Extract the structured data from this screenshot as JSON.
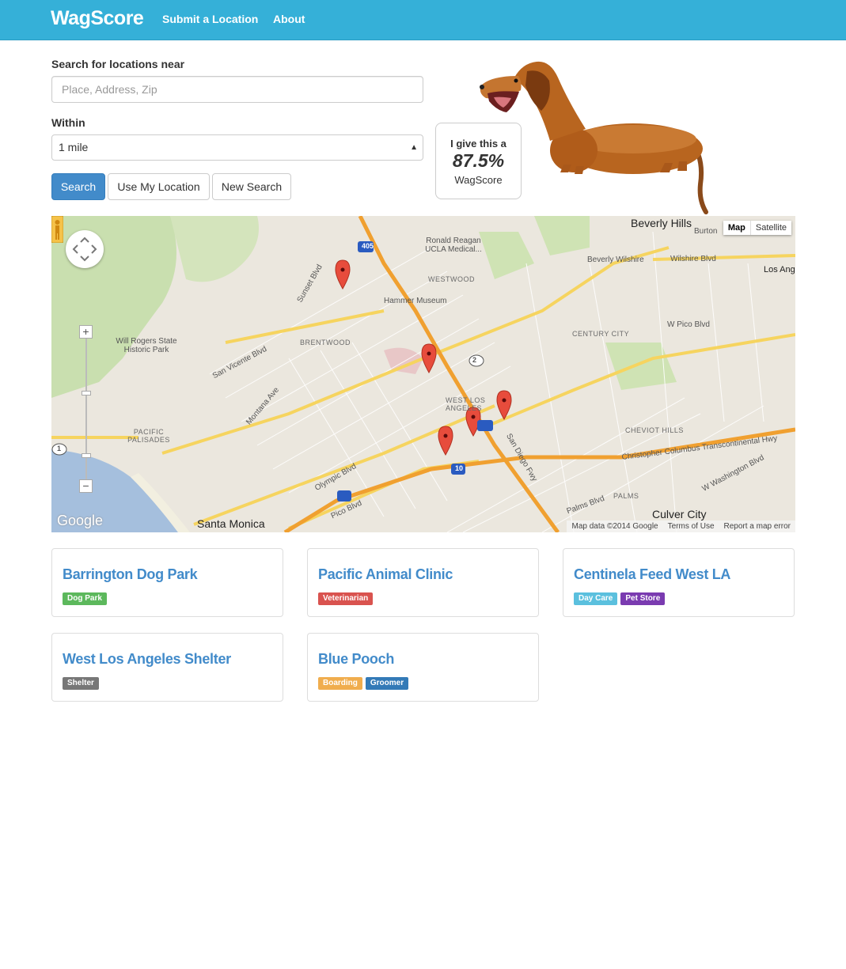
{
  "nav": {
    "brand": "WagScore",
    "links": [
      "Submit a Location",
      "About"
    ]
  },
  "search": {
    "near_label": "Search for locations near",
    "near_placeholder": "Place, Address, Zip",
    "near_value": "",
    "within_label": "Within",
    "within_selected": "1 mile",
    "buttons": {
      "search": "Search",
      "use_location": "Use My Location",
      "new_search": "New Search"
    }
  },
  "score": {
    "prefix": "I give this a",
    "value": "87.5%",
    "suffix": "WagScore"
  },
  "map": {
    "type_buttons": [
      "Map",
      "Satellite"
    ],
    "attribution": "Map data ©2014 Google",
    "terms": "Terms of Use",
    "report": "Report a map error",
    "google_logo": "Google",
    "labels": {
      "beverly_hills": "Beverly Hills",
      "burton": "Burton",
      "santa_monica": "Santa Monica",
      "culver_city": "Culver City",
      "brentwood": "BRENTWOOD",
      "westwood": "WESTWOOD",
      "west_la": "WEST LOS ANGELES",
      "century_city": "CENTURY CITY",
      "cheviot_hills": "CHEVIOT HILLS",
      "palms": "PALMS",
      "pacific_palisades": "PACIFIC PALISADES",
      "ronald_reagan": "Ronald Reagan UCLA Medical...",
      "hammer_museum": "Hammer Museum",
      "will_rogers": "Will Rogers State Historic Park",
      "beverly_wilshire": "Beverly Wilshire",
      "wilshire_blvd": "Wilshire Blvd",
      "w_pico_blvd": "W Pico Blvd",
      "pico_blvd": "Pico Blvd",
      "olympic_blvd": "Olympic Blvd",
      "san_vicente": "San Vicente Blvd",
      "sunset_blvd": "Sunset Blvd",
      "montana_ave": "Montana Ave",
      "san_diego_fwy": "San Diego Fwy",
      "columbus_hwy": "Christopher Columbus Transcontinental Hwy",
      "w_washington": "W Washington Blvd",
      "palms_blvd": "Palms Blvd",
      "los_ang": "Los Ang",
      "i405": "405",
      "i10": "10",
      "rt2": "2",
      "rt1": "1"
    }
  },
  "results": [
    {
      "name": "Barrington Dog Park",
      "tags": [
        {
          "label": "Dog Park",
          "color": "#5cb85c"
        }
      ]
    },
    {
      "name": "Pacific Animal Clinic",
      "tags": [
        {
          "label": "Veterinarian",
          "color": "#d9534f"
        }
      ]
    },
    {
      "name": "Centinela Feed West LA",
      "tags": [
        {
          "label": "Day Care",
          "color": "#5bc0de"
        },
        {
          "label": "Pet Store",
          "color": "#7a3bb0"
        }
      ]
    },
    {
      "name": "West Los Angeles Shelter",
      "tags": [
        {
          "label": "Shelter",
          "color": "#777777"
        }
      ]
    },
    {
      "name": "Blue Pooch",
      "tags": [
        {
          "label": "Boarding",
          "color": "#f0ad4e"
        },
        {
          "label": "Groomer",
          "color": "#337ab7"
        }
      ]
    }
  ],
  "colors": {
    "navbar": "#35b0d8",
    "primary": "#428bca",
    "marker": "#e74c3c"
  }
}
